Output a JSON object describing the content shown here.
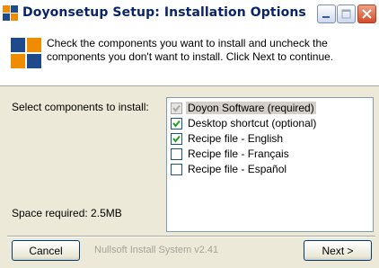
{
  "window": {
    "title": "Doyonsetup Setup: Installation Options",
    "buttons": [
      "minimize",
      "maximize",
      "close"
    ]
  },
  "header": {
    "description": "Check the components you want to install and uncheck the components you don't want to install. Click Next to continue."
  },
  "labels": {
    "select_components": "Select components to install:",
    "space_required": "Space required: 2.5MB"
  },
  "components": [
    {
      "label": "Doyon Software (required)",
      "checked": true,
      "disabled": true,
      "selected": true
    },
    {
      "label": "Desktop shortcut (optional)",
      "checked": true,
      "disabled": false,
      "selected": false
    },
    {
      "label": "Recipe file - English",
      "checked": true,
      "disabled": false,
      "selected": false
    },
    {
      "label": "Recipe file - Français",
      "checked": false,
      "disabled": false,
      "selected": false
    },
    {
      "label": "Recipe file - Español",
      "checked": false,
      "disabled": false,
      "selected": false
    }
  ],
  "footer": {
    "cancel_label": "Cancel",
    "branding": "Nullsoft Install System v2.41",
    "next_label": "Next >"
  },
  "colors": {
    "title_text": "#0a246a",
    "icon_orange": "#f08c00",
    "icon_blue": "#1e4a8c",
    "close_red": "#d24b2a",
    "dialog_bg": "#ece9d8"
  },
  "icons": {
    "app": "setup-app-icon",
    "header": "setup-header-icon"
  }
}
